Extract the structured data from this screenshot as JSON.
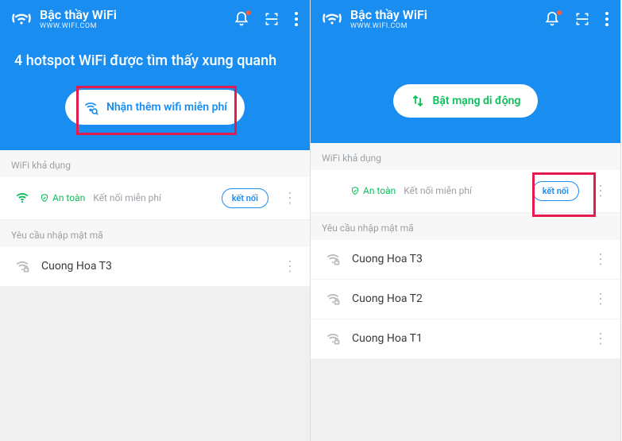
{
  "app": {
    "title": "Bậc thầy WiFi",
    "subtitle": "WWW.WIFI.COM"
  },
  "left": {
    "headline": "4 hotspot WiFi được tìm thấy xung quanh",
    "pill_label": "Nhận thêm wifi miễn phí",
    "section_available": "WiFi khả dụng",
    "safe_label": "An toàn",
    "free_connect_label": "Kết nối miễn phí",
    "connect_btn": "kết nối",
    "section_password": "Yêu cầu nhập mật mã",
    "networks": [
      {
        "name": "Cuong Hoa T3"
      }
    ]
  },
  "right": {
    "pill_label": "Bật mạng di động",
    "section_available": "WiFi khả dụng",
    "safe_label": "An toàn",
    "free_connect_label": "Kết nối miễn phí",
    "connect_btn": "kết nối",
    "section_password": "Yêu cầu nhập mật mã",
    "networks": [
      {
        "name": "Cuong Hoa T3"
      },
      {
        "name": "Cuong Hoa T2"
      },
      {
        "name": "Cuong Hoa T1"
      }
    ]
  }
}
